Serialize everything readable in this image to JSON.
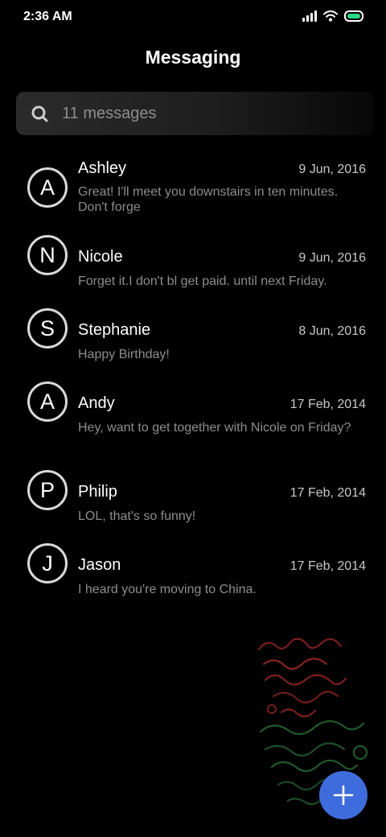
{
  "status_bar": {
    "time": "2:36 AM",
    "icons": [
      "signal-icon",
      "wifi-icon",
      "battery-icon"
    ],
    "battery_color": "#2bd98a"
  },
  "header": {
    "title": "Messaging"
  },
  "search": {
    "placeholder": "11 messages",
    "icon": "search-icon"
  },
  "conversations": [
    {
      "initial": "A",
      "name": "Ashley",
      "date": "9 Jun, 2016",
      "snippet": "Great! I'll meet you downstairs in ten minutes. Don't forge"
    },
    {
      "initial": "N",
      "name": "Nicole",
      "date": "9 Jun, 2016",
      "snippet": "Forget it.I don't bl get paid. until next Friday."
    },
    {
      "initial": "S",
      "name": "Stephanie",
      "date": "8 Jun, 2016",
      "snippet": "Happy Birthday!"
    },
    {
      "initial": "A",
      "name": "Andy",
      "date": "17 Feb, 2014",
      "snippet": "Hey, want to get together with Nicole on Friday?"
    },
    {
      "initial": "P",
      "name": "Philip",
      "date": "17 Feb, 2014",
      "snippet": "LOL, that's so funny!"
    },
    {
      "initial": "J",
      "name": "Jason",
      "date": "17 Feb, 2014",
      "snippet": "I heard you're moving to China."
    }
  ],
  "fab": {
    "icon": "plus-icon",
    "color": "#3f6cdc"
  },
  "colors": {
    "background": "#000000",
    "snippet": "#8d8d8d",
    "date": "#c8c8c8",
    "avatar_ring": "#d9d9d9"
  }
}
